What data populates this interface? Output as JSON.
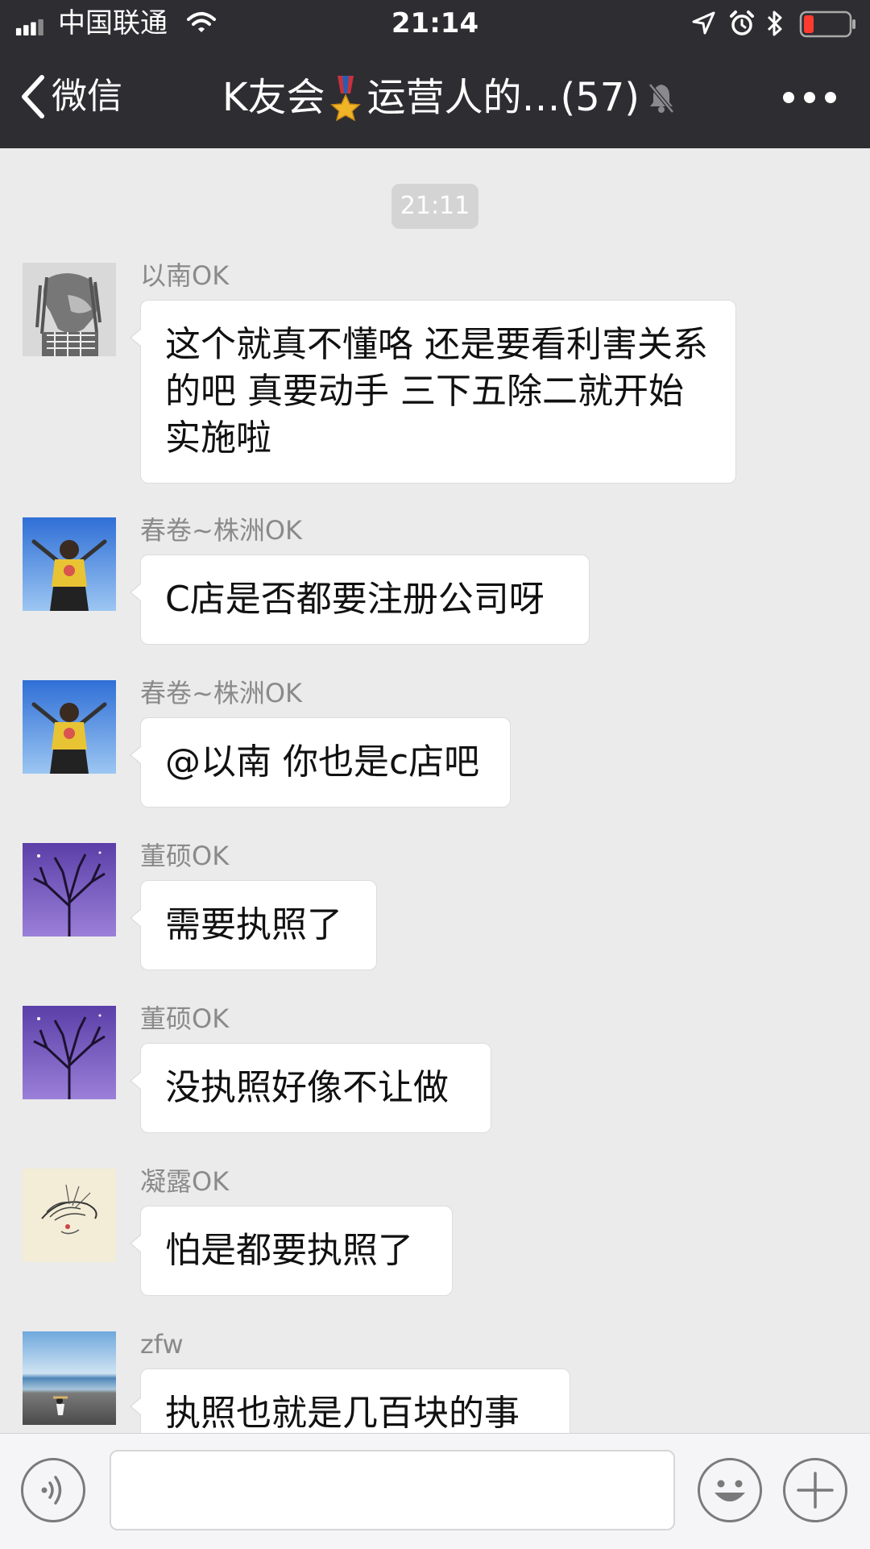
{
  "status_bar": {
    "carrier": "中国联通",
    "time": "21:14"
  },
  "nav": {
    "back_label": "微信",
    "title_prefix": "K友会",
    "title_suffix": "运营人的…(57)"
  },
  "chat": {
    "timestamp": "21:11",
    "messages": [
      {
        "sender": "以南OK",
        "text": "这个就真不懂咯 还是要看利害关系的吧 真要动手 三下五除二就开始实施啦",
        "avatar": "lion-avatar"
      },
      {
        "sender": "春卷~株洲OK",
        "text": "C店是否都要注册公司呀",
        "avatar": "sky-person-avatar"
      },
      {
        "sender": "春卷~株洲OK",
        "text": "@以南 你也是c店吧",
        "avatar": "sky-person-avatar"
      },
      {
        "sender": "董硕OK",
        "text": "需要执照了",
        "avatar": "purple-tree-avatar"
      },
      {
        "sender": "董硕OK",
        "text": "没执照好像不让做",
        "avatar": "purple-tree-avatar"
      },
      {
        "sender": "凝露OK",
        "text": "怕是都要执照了",
        "avatar": "sketch-avatar"
      },
      {
        "sender": "zfw",
        "text": "执照也就是几百块的事",
        "avatar": "beach-avatar"
      }
    ]
  },
  "input_bar": {
    "text_value": "",
    "icons": [
      "voice-icon",
      "emoji-icon",
      "plus-icon"
    ]
  },
  "colors": {
    "nav_bg": "#2e2e32",
    "chat_bg": "#ebebeb",
    "battery_low": "#ff3b30"
  }
}
